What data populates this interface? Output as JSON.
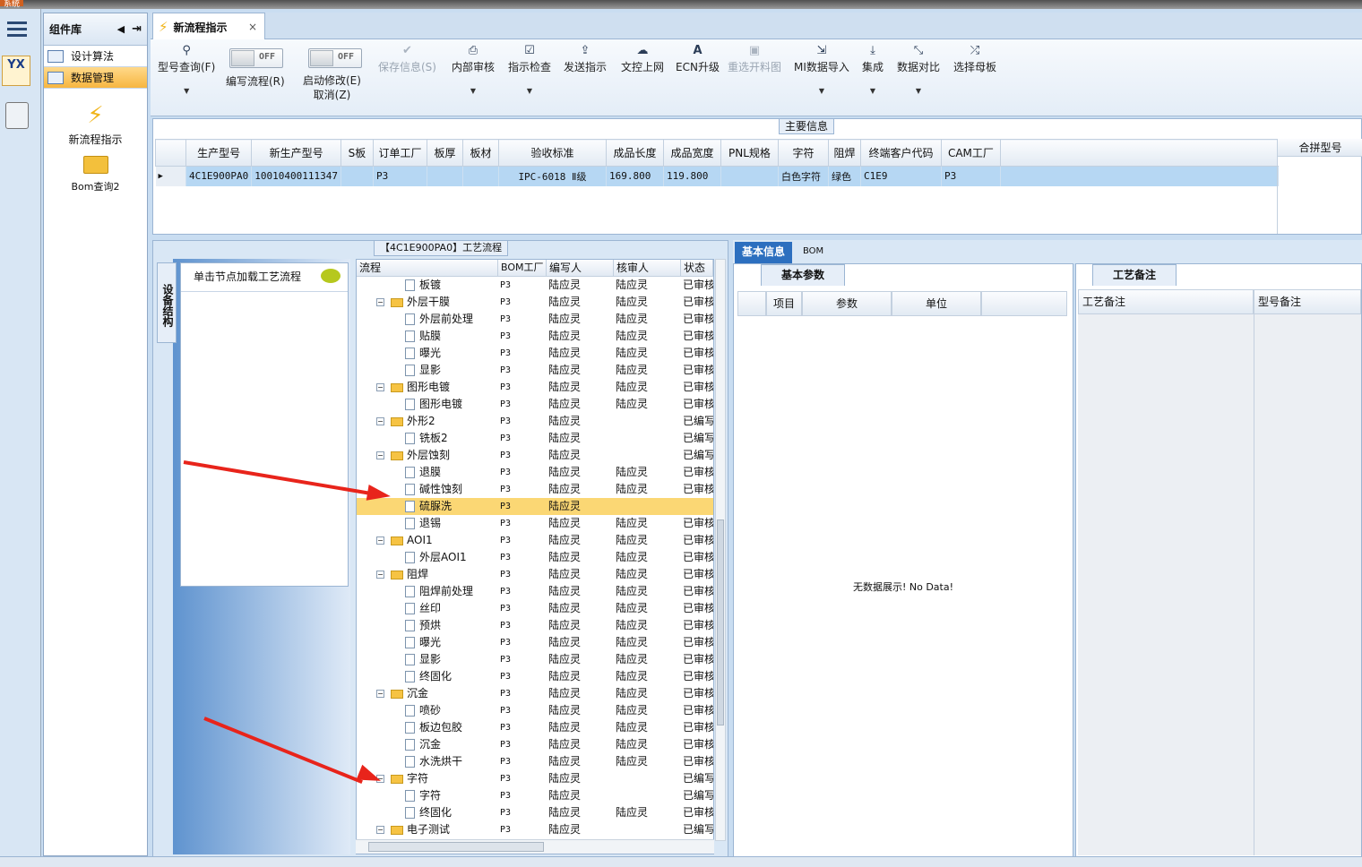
{
  "window": {
    "title": "系统"
  },
  "sidebar": {
    "header": "组件库",
    "items": [
      {
        "label": "设计算法"
      },
      {
        "label": "数据管理",
        "selected": true
      }
    ],
    "apps": [
      {
        "label": "新流程指示",
        "icon": "lightning-icon"
      },
      {
        "label": "Bom查询2",
        "icon": "folder-icon"
      }
    ]
  },
  "tabs": [
    {
      "label": "新流程指示",
      "close": "×"
    }
  ],
  "toolbar": {
    "buttons": [
      {
        "label": "型号查询(F)",
        "icon": "search-icon"
      },
      {
        "label": "保存信息(S)",
        "icon": "check-icon",
        "disabled": true
      },
      {
        "label": "内部审核",
        "icon": "print-icon"
      },
      {
        "label": "指示检查",
        "icon": "checkbox-icon"
      },
      {
        "label": "发送指示",
        "icon": "upload-icon"
      },
      {
        "label": "文控上网",
        "icon": "cloud-upload-icon"
      },
      {
        "label": "ECN升级",
        "icon": "font-icon"
      },
      {
        "label": "重选开料图",
        "icon": "image-icon",
        "disabled": true
      },
      {
        "label": "MI数据导入",
        "icon": "import-icon"
      },
      {
        "label": "集成",
        "icon": "download-icon"
      },
      {
        "label": "数据对比",
        "icon": "compress-icon"
      },
      {
        "label": "选择母板",
        "icon": "shuffle-icon"
      }
    ],
    "toggles": [
      {
        "label": "编写流程(R)",
        "state": "OFF"
      },
      {
        "label": "启动修改(E)",
        "state": "OFF",
        "sub": "取消(Z)"
      }
    ]
  },
  "main_info": {
    "title": "主要信息",
    "columns": [
      "生产型号",
      "新生产型号",
      "S板",
      "订单工厂",
      "板厚",
      "板材",
      "验收标准",
      "成品长度",
      "成品宽度",
      "PNL规格",
      "字符",
      "阻焊",
      "终端客户代码",
      "CAM工厂"
    ],
    "row": [
      "4C1E900PA0",
      "10010400111347",
      "",
      "P3",
      "",
      "",
      "IPC-6018 Ⅱ级",
      "169.800",
      "119.800",
      "",
      "白色字符",
      "绿色",
      "C1E9",
      "P3"
    ],
    "merge_header": "合拼型号"
  },
  "flow": {
    "title": "【4C1E900PA0】工艺流程",
    "vtab": "设备结构",
    "hint": "单击节点加载工艺流程",
    "columns": [
      "流程",
      "BOM工厂",
      "编写人",
      "核审人",
      "状态"
    ],
    "rows": [
      {
        "name": "板镀",
        "level": 2,
        "bom": "P3",
        "writer": "陆应灵",
        "reviewer": "陆应灵",
        "status": "已审核"
      },
      {
        "name": "外层干膜",
        "level": 1,
        "bom": "P3",
        "writer": "陆应灵",
        "reviewer": "陆应灵",
        "status": "已审核"
      },
      {
        "name": "外层前处理",
        "level": 2,
        "bom": "P3",
        "writer": "陆应灵",
        "reviewer": "陆应灵",
        "status": "已审核"
      },
      {
        "name": "贴膜",
        "level": 2,
        "bom": "P3",
        "writer": "陆应灵",
        "reviewer": "陆应灵",
        "status": "已审核"
      },
      {
        "name": "曝光",
        "level": 2,
        "bom": "P3",
        "writer": "陆应灵",
        "reviewer": "陆应灵",
        "status": "已审核"
      },
      {
        "name": "显影",
        "level": 2,
        "bom": "P3",
        "writer": "陆应灵",
        "reviewer": "陆应灵",
        "status": "已审核"
      },
      {
        "name": "图形电镀",
        "level": 1,
        "bom": "P3",
        "writer": "陆应灵",
        "reviewer": "陆应灵",
        "status": "已审核"
      },
      {
        "name": "图形电镀",
        "level": 2,
        "bom": "P3",
        "writer": "陆应灵",
        "reviewer": "陆应灵",
        "status": "已审核"
      },
      {
        "name": "外形2",
        "level": 1,
        "bom": "P3",
        "writer": "陆应灵",
        "reviewer": "",
        "status": "已编写"
      },
      {
        "name": "铣板2",
        "level": 2,
        "bom": "P3",
        "writer": "陆应灵",
        "reviewer": "",
        "status": "已编写"
      },
      {
        "name": "外层蚀刻",
        "level": 1,
        "bom": "P3",
        "writer": "陆应灵",
        "reviewer": "",
        "status": "已编写"
      },
      {
        "name": "退膜",
        "level": 2,
        "bom": "P3",
        "writer": "陆应灵",
        "reviewer": "陆应灵",
        "status": "已审核"
      },
      {
        "name": "碱性蚀刻",
        "level": 2,
        "bom": "P3",
        "writer": "陆应灵",
        "reviewer": "陆应灵",
        "status": "已审核"
      },
      {
        "name": "硫脲洗",
        "level": 2,
        "bom": "P3",
        "writer": "陆应灵",
        "reviewer": "",
        "status": "",
        "selected": true
      },
      {
        "name": "退锡",
        "level": 2,
        "bom": "P3",
        "writer": "陆应灵",
        "reviewer": "陆应灵",
        "status": "已审核"
      },
      {
        "name": "AOI1",
        "level": 1,
        "bom": "P3",
        "writer": "陆应灵",
        "reviewer": "陆应灵",
        "status": "已审核"
      },
      {
        "name": "外层AOI1",
        "level": 2,
        "bom": "P3",
        "writer": "陆应灵",
        "reviewer": "陆应灵",
        "status": "已审核"
      },
      {
        "name": "阻焊",
        "level": 1,
        "bom": "P3",
        "writer": "陆应灵",
        "reviewer": "陆应灵",
        "status": "已审核"
      },
      {
        "name": "阻焊前处理",
        "level": 2,
        "bom": "P3",
        "writer": "陆应灵",
        "reviewer": "陆应灵",
        "status": "已审核"
      },
      {
        "name": "丝印",
        "level": 2,
        "bom": "P3",
        "writer": "陆应灵",
        "reviewer": "陆应灵",
        "status": "已审核"
      },
      {
        "name": "预烘",
        "level": 2,
        "bom": "P3",
        "writer": "陆应灵",
        "reviewer": "陆应灵",
        "status": "已审核"
      },
      {
        "name": "曝光",
        "level": 2,
        "bom": "P3",
        "writer": "陆应灵",
        "reviewer": "陆应灵",
        "status": "已审核"
      },
      {
        "name": "显影",
        "level": 2,
        "bom": "P3",
        "writer": "陆应灵",
        "reviewer": "陆应灵",
        "status": "已审核"
      },
      {
        "name": "终固化",
        "level": 2,
        "bom": "P3",
        "writer": "陆应灵",
        "reviewer": "陆应灵",
        "status": "已审核"
      },
      {
        "name": "沉金",
        "level": 1,
        "bom": "P3",
        "writer": "陆应灵",
        "reviewer": "陆应灵",
        "status": "已审核"
      },
      {
        "name": "喷砂",
        "level": 2,
        "bom": "P3",
        "writer": "陆应灵",
        "reviewer": "陆应灵",
        "status": "已审核"
      },
      {
        "name": "板边包胶",
        "level": 2,
        "bom": "P3",
        "writer": "陆应灵",
        "reviewer": "陆应灵",
        "status": "已审核"
      },
      {
        "name": "沉金",
        "level": 2,
        "bom": "P3",
        "writer": "陆应灵",
        "reviewer": "陆应灵",
        "status": "已审核"
      },
      {
        "name": "水洗烘干",
        "level": 2,
        "bom": "P3",
        "writer": "陆应灵",
        "reviewer": "陆应灵",
        "status": "已审核"
      },
      {
        "name": "字符",
        "level": 1,
        "bom": "P3",
        "writer": "陆应灵",
        "reviewer": "",
        "status": "已编写"
      },
      {
        "name": "字符",
        "level": 2,
        "bom": "P3",
        "writer": "陆应灵",
        "reviewer": "",
        "status": "已编写"
      },
      {
        "name": "终固化",
        "level": 2,
        "bom": "P3",
        "writer": "陆应灵",
        "reviewer": "陆应灵",
        "status": "已审核"
      },
      {
        "name": "电子测试",
        "level": 1,
        "bom": "P3",
        "writer": "陆应灵",
        "reviewer": "",
        "status": "已编写"
      }
    ]
  },
  "right": {
    "tabs": [
      "基本信息",
      "BOM"
    ],
    "basic": {
      "subtab": "基本参数",
      "columns": [
        "项目",
        "参数",
        "单位"
      ],
      "empty": "无数据展示! No Data!"
    },
    "remark": {
      "subtab": "工艺备注",
      "columns": [
        "工艺备注",
        "型号备注"
      ]
    }
  },
  "colors": {
    "accent": "#f7b640",
    "selected_row": "#fbd774",
    "grid_selected": "#b6d7f3",
    "annotation_arrow": "#e8241b"
  }
}
